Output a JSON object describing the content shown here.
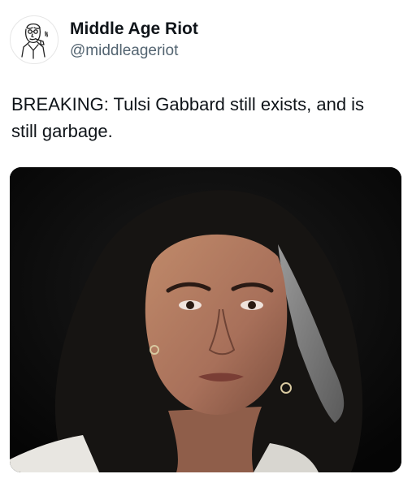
{
  "post": {
    "author": {
      "display_name": "Middle Age Riot",
      "handle": "@middleageriot",
      "avatar_icon": "retro-man-sketch-icon"
    },
    "text": "BREAKING: Tulsi Gabbard still exists, and is still garbage.",
    "media": {
      "type": "photo",
      "alt": ""
    }
  },
  "colors": {
    "text_primary": "#0f1419",
    "text_secondary": "#536471",
    "background": "#ffffff",
    "media_background": "#0a0a0a"
  }
}
